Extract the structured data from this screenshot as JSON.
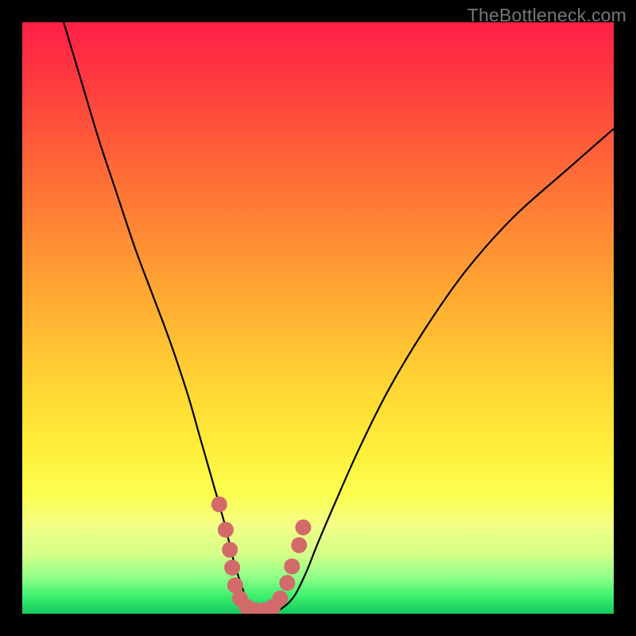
{
  "watermark": "TheBottleneck.com",
  "chart_data": {
    "type": "line",
    "title": "",
    "xlabel": "",
    "ylabel": "",
    "xlim": [
      0,
      100
    ],
    "ylim": [
      0,
      100
    ],
    "series": [
      {
        "name": "bottleneck-curve",
        "x": [
          7,
          10,
          13,
          16,
          19,
          22,
          25,
          28,
          30,
          32,
          34,
          35,
          36,
          37,
          38,
          39,
          40,
          42,
          44,
          46,
          48,
          50,
          53,
          57,
          62,
          68,
          75,
          83,
          92,
          100
        ],
        "y": [
          100,
          90,
          80,
          71,
          62,
          54,
          46,
          37,
          30,
          23,
          16,
          12,
          8,
          5,
          2,
          0,
          0,
          0,
          1,
          3,
          7,
          12,
          19,
          28,
          38,
          48,
          58,
          67,
          75,
          82
        ]
      }
    ],
    "markers": {
      "name": "highlight-dots",
      "color": "#d36a6a",
      "points_xy": [
        [
          33.3,
          18.5
        ],
        [
          34.4,
          14.2
        ],
        [
          35.1,
          10.8
        ],
        [
          35.5,
          7.8
        ],
        [
          36.0,
          4.8
        ],
        [
          36.8,
          2.6
        ],
        [
          37.9,
          1.2
        ],
        [
          39.4,
          0.6
        ],
        [
          41.0,
          0.6
        ],
        [
          42.4,
          1.2
        ],
        [
          43.6,
          2.6
        ],
        [
          44.8,
          5.2
        ],
        [
          45.6,
          8.0
        ],
        [
          46.8,
          11.6
        ],
        [
          47.5,
          14.6
        ]
      ]
    },
    "colors": {
      "curve": "#000000",
      "markers": "#d36a6a",
      "gradient_top": "#ff1f47",
      "gradient_bottom": "#14c95e",
      "frame": "#000000"
    }
  }
}
